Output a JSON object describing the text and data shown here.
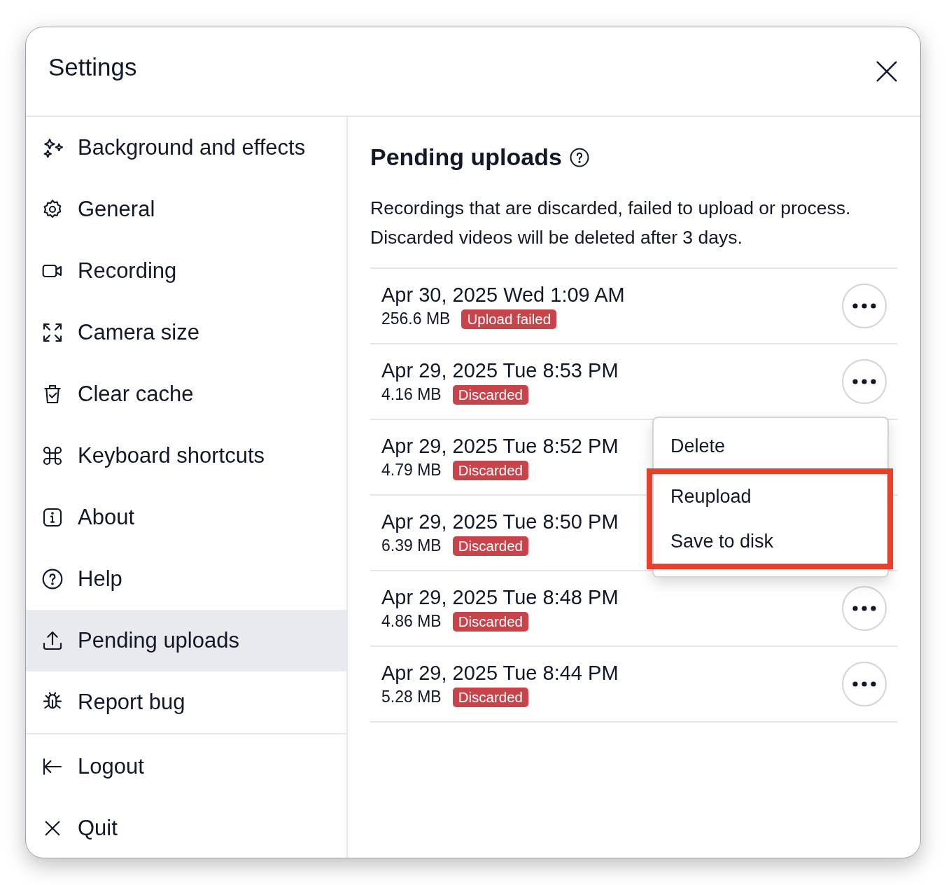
{
  "window": {
    "title": "Settings"
  },
  "sidebar": {
    "items": [
      {
        "label": "Background and effects",
        "selected": false
      },
      {
        "label": "General",
        "selected": false
      },
      {
        "label": "Recording",
        "selected": false
      },
      {
        "label": "Camera size",
        "selected": false
      },
      {
        "label": "Clear cache",
        "selected": false
      },
      {
        "label": "Keyboard shortcuts",
        "selected": false
      },
      {
        "label": "About",
        "selected": false
      },
      {
        "label": "Help",
        "selected": false
      },
      {
        "label": "Pending uploads",
        "selected": true
      },
      {
        "label": "Report bug",
        "selected": false
      }
    ],
    "footer_items": [
      {
        "label": "Logout"
      },
      {
        "label": "Quit"
      }
    ]
  },
  "content": {
    "heading": "Pending uploads",
    "description": "Recordings that are discarded, failed to upload or process. Discarded videos will be deleted after 3 days.",
    "uploads": [
      {
        "date": "Apr 30, 2025 Wed 1:09 AM",
        "size": "256.6 MB",
        "status": "Upload failed",
        "menu_button": true
      },
      {
        "date": "Apr 29, 2025 Tue 8:53 PM",
        "size": "4.16 MB",
        "status": "Discarded",
        "menu_button": true
      },
      {
        "date": "Apr 29, 2025 Tue 8:52 PM",
        "size": "4.79 MB",
        "status": "Discarded",
        "menu_button": false
      },
      {
        "date": "Apr 29, 2025 Tue 8:50 PM",
        "size": "6.39 MB",
        "status": "Discarded",
        "menu_button": false
      },
      {
        "date": "Apr 29, 2025 Tue 8:48 PM",
        "size": "4.86 MB",
        "status": "Discarded",
        "menu_button": true
      },
      {
        "date": "Apr 29, 2025 Tue 8:44 PM",
        "size": "5.28 MB",
        "status": "Discarded",
        "menu_button": true
      }
    ],
    "context_menu": {
      "items": [
        {
          "label": "Delete",
          "highlighted": false
        },
        {
          "label": "Reupload",
          "highlighted": true
        },
        {
          "label": "Save to disk",
          "highlighted": true
        }
      ]
    }
  }
}
